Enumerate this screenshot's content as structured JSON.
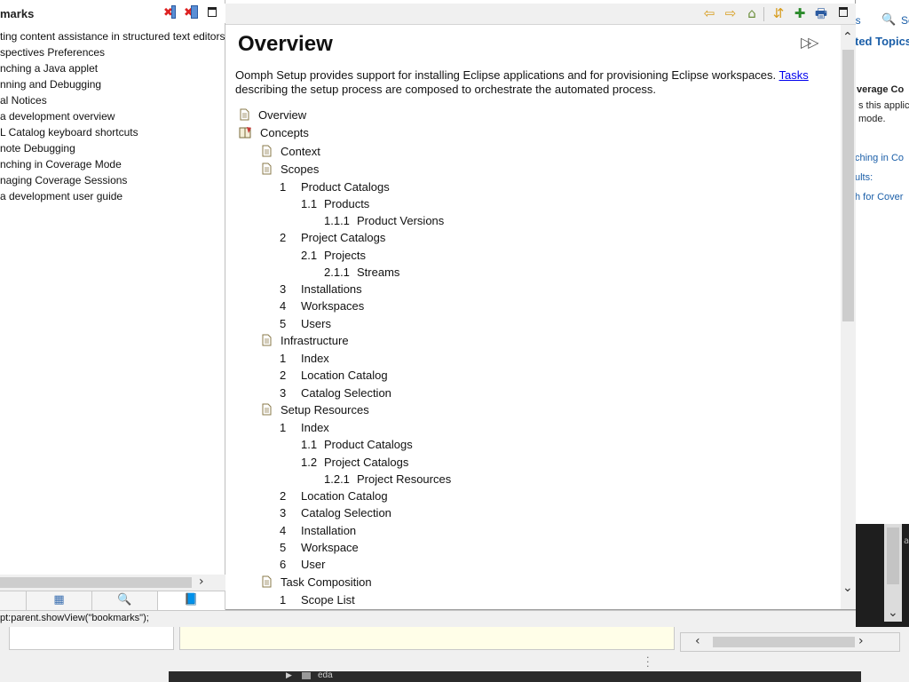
{
  "bookmarks_view": {
    "title": "marks",
    "items": [
      "ting content assistance in structured text editors",
      "spectives Preferences",
      "nching a Java applet",
      "nning and Debugging",
      "al Notices",
      "a development overview",
      "L Catalog keyboard shortcuts",
      "note Debugging",
      "nching in Coverage Mode",
      "naging Coverage Sessions",
      "a development user guide"
    ],
    "status_text": "pt:parent.showView(\"bookmarks\");"
  },
  "help": {
    "title": "Overview",
    "intro_text": "Oomph Setup provides support for installing Eclipse applications and for provisioning Eclipse workspaces. ",
    "intro_link": "Tasks",
    "intro_text_after": "describing the setup process are composed to orchestrate the automated process.",
    "toc": [
      {
        "label": "Overview",
        "num": "",
        "icon": "doc"
      },
      {
        "label": "Concepts",
        "num": "",
        "icon": "book"
      },
      {
        "label": "Context",
        "num": "",
        "icon": "doc"
      },
      {
        "label": "Scopes",
        "num": "",
        "icon": "doc"
      },
      {
        "label": "Product Catalogs",
        "num": "1",
        "icon": ""
      },
      {
        "label": "Products",
        "num": "1.1",
        "icon": ""
      },
      {
        "label": "Product Versions",
        "num": "1.1.1",
        "icon": ""
      },
      {
        "label": "Project Catalogs",
        "num": "2",
        "icon": ""
      },
      {
        "label": "Projects",
        "num": "2.1",
        "icon": ""
      },
      {
        "label": "Streams",
        "num": "2.1.1",
        "icon": ""
      },
      {
        "label": "Installations",
        "num": "3",
        "icon": ""
      },
      {
        "label": "Workspaces",
        "num": "4",
        "icon": ""
      },
      {
        "label": "Users",
        "num": "5",
        "icon": ""
      },
      {
        "label": "Infrastructure",
        "num": "",
        "icon": "doc"
      },
      {
        "label": "Index",
        "num": "1",
        "icon": ""
      },
      {
        "label": "Location Catalog",
        "num": "2",
        "icon": ""
      },
      {
        "label": "Catalog Selection",
        "num": "3",
        "icon": ""
      },
      {
        "label": "Setup Resources",
        "num": "",
        "icon": "doc"
      },
      {
        "label": "Index",
        "num": "1",
        "icon": ""
      },
      {
        "label": "Product Catalogs",
        "num": "1.1",
        "icon": ""
      },
      {
        "label": "Project Catalogs",
        "num": "1.2",
        "icon": ""
      },
      {
        "label": "Project Resources",
        "num": "1.2.1",
        "icon": ""
      },
      {
        "label": "Location Catalog",
        "num": "2",
        "icon": ""
      },
      {
        "label": "Catalog Selection",
        "num": "3",
        "icon": ""
      },
      {
        "label": "Installation",
        "num": "4",
        "icon": ""
      },
      {
        "label": "Workspace",
        "num": "5",
        "icon": ""
      },
      {
        "label": "User",
        "num": "6",
        "icon": ""
      },
      {
        "label": "Task Composition",
        "num": "",
        "icon": "doc"
      },
      {
        "label": "Scope List",
        "num": "1",
        "icon": ""
      }
    ]
  },
  "background_right": {
    "line1": "ents",
    "line1b": "Se",
    "heading": "ted Topics",
    "line3": "verage Co",
    "line4": "s this applic",
    "line5": " mode.",
    "link1": "ching in Co",
    "link2": "ults:",
    "link3": "h for Cover"
  },
  "taskbar": {
    "label": "eda"
  },
  "colors": {
    "link": "#0000ee",
    "help_link": "#1a5ea8"
  }
}
